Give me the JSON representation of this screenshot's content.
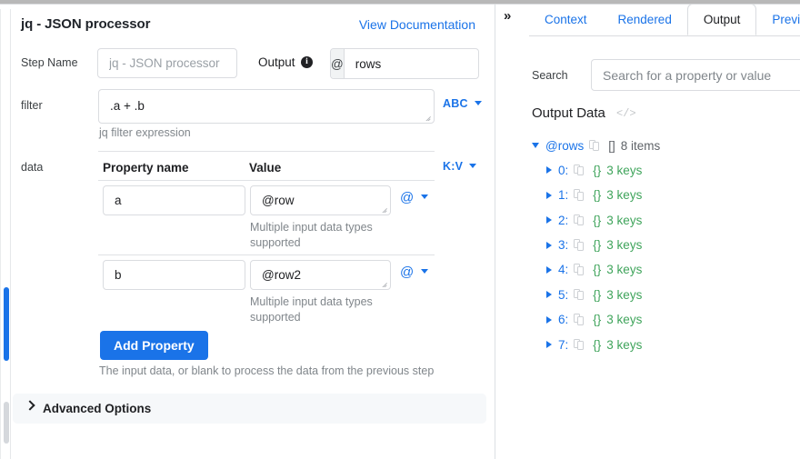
{
  "left_panel": {
    "title": "jq - JSON processor",
    "documentation_link": "View Documentation",
    "step_name": {
      "label": "Step Name",
      "value": "jq - JSON processor",
      "placeholder": "jq - JSON processor"
    },
    "output": {
      "label": "Output",
      "info_icon": "info-icon",
      "prefix": "@",
      "value": "rows"
    },
    "filter": {
      "label": "filter",
      "value": ".a + .b",
      "helper": "jq filter expression",
      "type_toggle": "ABC"
    },
    "data": {
      "label": "data",
      "type_toggle": "K:V",
      "columns": {
        "property_name": "Property name",
        "value": "Value"
      },
      "rows": [
        {
          "property_name": "a",
          "value": "@row",
          "helper": "Multiple input data types supported",
          "type_toggle": "@"
        },
        {
          "property_name": "b",
          "value": "@row2",
          "helper": "Multiple input data types supported",
          "type_toggle": "@"
        }
      ],
      "add_button": "Add Property",
      "helper": "The input data, or blank to process the data from the previous step"
    },
    "advanced_options": {
      "label": "Advanced Options",
      "chevron": "chevron-right-icon"
    }
  },
  "right_panel": {
    "collapse_icon": "»",
    "tabs": [
      {
        "label": "Context",
        "active": false
      },
      {
        "label": "Rendered",
        "active": false
      },
      {
        "label": "Output",
        "active": true
      },
      {
        "label": "Preview",
        "active": false
      }
    ],
    "search": {
      "label": "Search",
      "value": "",
      "placeholder": "Search for a property or value"
    },
    "output_data": {
      "title": "Output Data",
      "code_icon": "</>",
      "root": {
        "key": "@rows",
        "braces": "[]",
        "count": "8 items",
        "expanded": true
      },
      "items": [
        {
          "key": "0:",
          "braces": "{}",
          "count": "3 keys"
        },
        {
          "key": "1:",
          "braces": "{}",
          "count": "3 keys"
        },
        {
          "key": "2:",
          "braces": "{}",
          "count": "3 keys"
        },
        {
          "key": "3:",
          "braces": "{}",
          "count": "3 keys"
        },
        {
          "key": "4:",
          "braces": "{}",
          "count": "3 keys"
        },
        {
          "key": "5:",
          "braces": "{}",
          "count": "3 keys"
        },
        {
          "key": "6:",
          "braces": "{}",
          "count": "3 keys"
        },
        {
          "key": "7:",
          "braces": "{}",
          "count": "3 keys"
        }
      ]
    }
  },
  "colors": {
    "accent_blue": "#1a73e8",
    "green": "#3fa45b",
    "text": "#202124",
    "muted": "#80868b",
    "border": "#dadce0",
    "panel_bg": "#f6f8fa"
  }
}
